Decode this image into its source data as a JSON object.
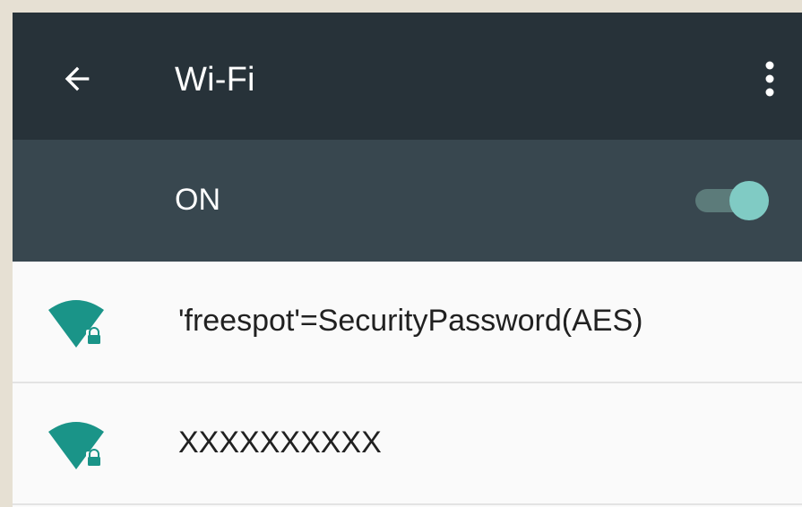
{
  "app_bar": {
    "title": "Wi-Fi",
    "back_icon": "arrow-back-icon",
    "menu_icon": "more-vert-icon"
  },
  "wifi_toggle": {
    "label": "ON",
    "checked": true
  },
  "networks": [
    {
      "ssid": "'freespot'=SecurityPassword(AES)",
      "icon": "wifi-lock-icon"
    },
    {
      "ssid": "XXXXXXXXXX",
      "icon": "wifi-lock-icon"
    }
  ],
  "colors": {
    "app_bar_bg": "#273239",
    "toggle_bar_bg": "#38474f",
    "accent": "#80cbc4",
    "wifi_icon": "#1a9488"
  }
}
